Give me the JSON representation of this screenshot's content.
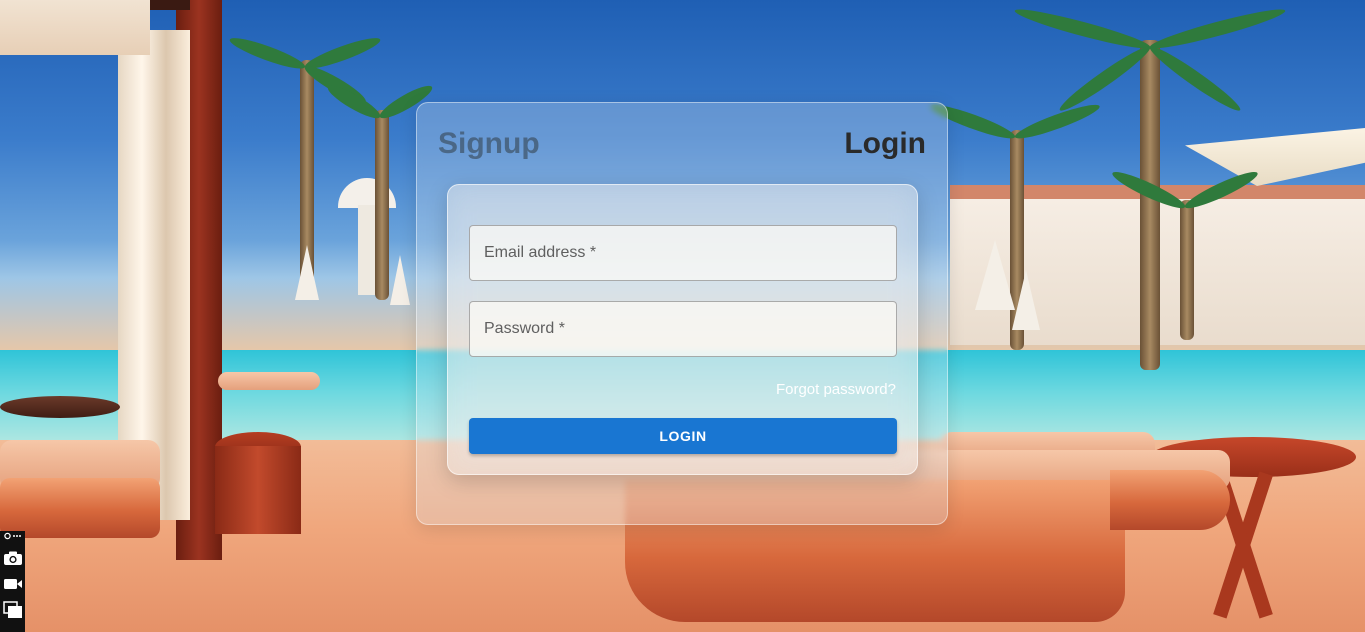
{
  "tabs": {
    "signup": "Signup",
    "login": "Login"
  },
  "form": {
    "email_placeholder": "Email address *",
    "password_placeholder": "Password *",
    "forgot_password": "Forgot password?",
    "login_button": "LOGIN"
  },
  "colors": {
    "accent": "#1976d2",
    "active_tab": "#2a2a2a",
    "inactive_tab": "#56616b"
  },
  "toolbar": {
    "icons": [
      "settings-more-icon",
      "camera-icon",
      "video-camera-icon",
      "windows-icon"
    ]
  }
}
